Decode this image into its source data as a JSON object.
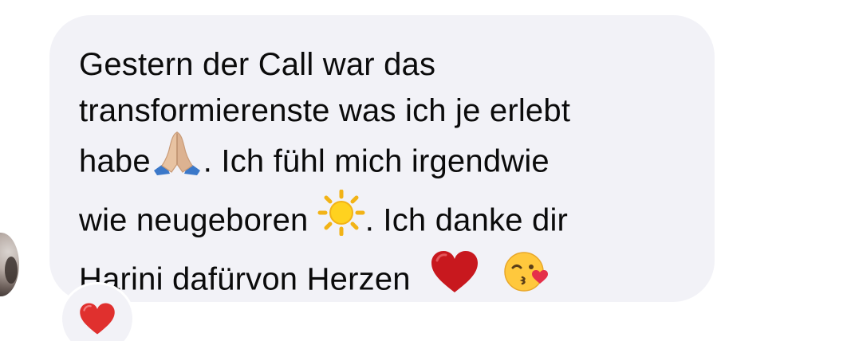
{
  "message": {
    "lines": [
      "Gestern der Call war das",
      "transformierenste was ich je erlebt",
      "habe",
      ". Ich fühl mich irgendwie",
      "wie neugeboren",
      ". Ich danke dir",
      "Harini dafürvon Herzen"
    ],
    "emojis": {
      "after_habe": "praying-hands-icon",
      "after_neugeboren": "sun-icon",
      "end_1": "red-heart-icon",
      "end_2": "kissing-face-icon"
    }
  },
  "reaction": {
    "icon": "red-heart-icon",
    "color": "#e0302e"
  },
  "colors": {
    "bubble": "#f2f2f7",
    "text": "#0b0b0b",
    "background": "#ffffff"
  }
}
